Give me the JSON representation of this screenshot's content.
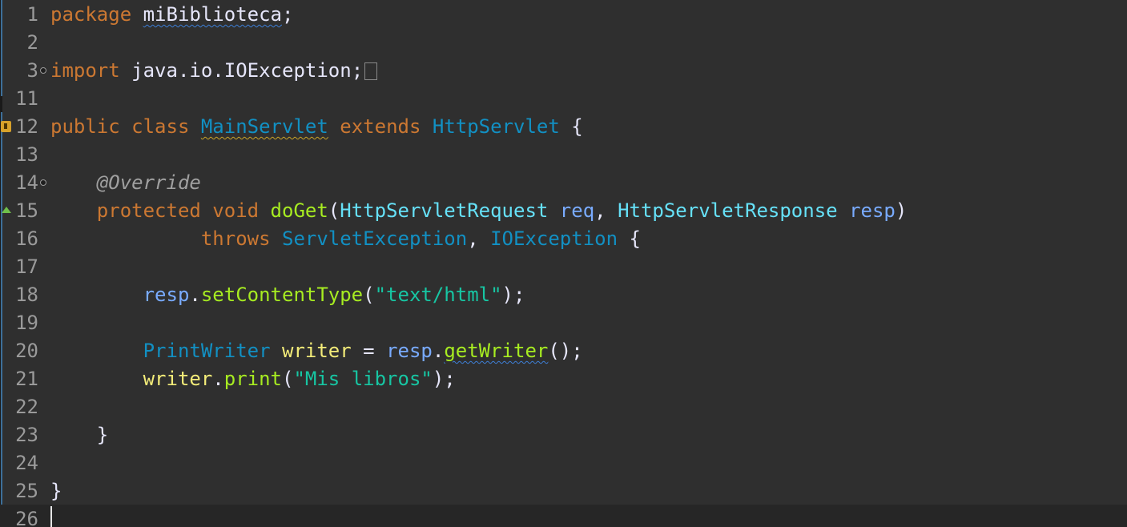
{
  "editor": {
    "lines": [
      {
        "num": "1",
        "tokens": [
          {
            "t": "package",
            "c": "kw"
          },
          {
            "t": " ",
            "c": "plain"
          },
          {
            "t": "miBiblioteca",
            "c": "plain",
            "u": "blue"
          },
          {
            "t": ";",
            "c": "plain"
          }
        ]
      },
      {
        "num": "2",
        "tokens": []
      },
      {
        "num": "3",
        "fold": "collapsed",
        "tokens": [
          {
            "t": "import",
            "c": "kw"
          },
          {
            "t": " java.io.IOException;",
            "c": "plain"
          }
        ]
      },
      {
        "num": "11",
        "tokens": []
      },
      {
        "num": "12",
        "marker": "warning",
        "tokens": [
          {
            "t": "public",
            "c": "kw"
          },
          {
            "t": " ",
            "c": "plain"
          },
          {
            "t": "class",
            "c": "kw"
          },
          {
            "t": " ",
            "c": "plain"
          },
          {
            "t": "MainServlet",
            "c": "cls",
            "u": "gold"
          },
          {
            "t": " ",
            "c": "plain"
          },
          {
            "t": "extends",
            "c": "kw"
          },
          {
            "t": " ",
            "c": "plain"
          },
          {
            "t": "HttpServlet",
            "c": "cls"
          },
          {
            "t": " {",
            "c": "plain"
          }
        ]
      },
      {
        "num": "13",
        "tokens": []
      },
      {
        "num": "14",
        "fold": "expanded",
        "tokens": [
          {
            "t": "    ",
            "c": "plain"
          },
          {
            "t": "@Override",
            "c": "ann"
          }
        ]
      },
      {
        "num": "15",
        "marker": "override",
        "tokens": [
          {
            "t": "    ",
            "c": "plain"
          },
          {
            "t": "protected",
            "c": "kw"
          },
          {
            "t": " ",
            "c": "plain"
          },
          {
            "t": "void",
            "c": "kw"
          },
          {
            "t": " ",
            "c": "plain"
          },
          {
            "t": "doGet",
            "c": "fn"
          },
          {
            "t": "(",
            "c": "plain"
          },
          {
            "t": "HttpServletRequest",
            "c": "fld"
          },
          {
            "t": " ",
            "c": "plain"
          },
          {
            "t": "req",
            "c": "var"
          },
          {
            "t": ", ",
            "c": "plain"
          },
          {
            "t": "HttpServletResponse",
            "c": "fld"
          },
          {
            "t": " ",
            "c": "plain"
          },
          {
            "t": "resp",
            "c": "var"
          },
          {
            "t": ")",
            "c": "plain"
          }
        ]
      },
      {
        "num": "16",
        "tokens": [
          {
            "t": "             ",
            "c": "plain"
          },
          {
            "t": "throws",
            "c": "kw"
          },
          {
            "t": " ",
            "c": "plain"
          },
          {
            "t": "ServletException",
            "c": "cls"
          },
          {
            "t": ", ",
            "c": "plain"
          },
          {
            "t": "IOException",
            "c": "cls"
          },
          {
            "t": " {",
            "c": "plain"
          }
        ]
      },
      {
        "num": "17",
        "tokens": []
      },
      {
        "num": "18",
        "tokens": [
          {
            "t": "        ",
            "c": "plain"
          },
          {
            "t": "resp",
            "c": "var"
          },
          {
            "t": ".",
            "c": "plain"
          },
          {
            "t": "setContentType",
            "c": "fn"
          },
          {
            "t": "(",
            "c": "plain"
          },
          {
            "t": "\"text/html\"",
            "c": "str"
          },
          {
            "t": ");",
            "c": "plain"
          }
        ]
      },
      {
        "num": "19",
        "tokens": []
      },
      {
        "num": "20",
        "tokens": [
          {
            "t": "        ",
            "c": "plain"
          },
          {
            "t": "PrintWriter",
            "c": "cls"
          },
          {
            "t": " ",
            "c": "plain"
          },
          {
            "t": "writer",
            "c": "loc"
          },
          {
            "t": " = ",
            "c": "plain"
          },
          {
            "t": "resp",
            "c": "var"
          },
          {
            "t": ".",
            "c": "plain"
          },
          {
            "t": "getWriter",
            "c": "fn",
            "u": "blue"
          },
          {
            "t": "();",
            "c": "plain"
          }
        ]
      },
      {
        "num": "21",
        "tokens": [
          {
            "t": "        ",
            "c": "plain"
          },
          {
            "t": "writer",
            "c": "loc"
          },
          {
            "t": ".",
            "c": "plain"
          },
          {
            "t": "print",
            "c": "fn"
          },
          {
            "t": "(",
            "c": "plain"
          },
          {
            "t": "\"Mis libros\"",
            "c": "str"
          },
          {
            "t": ");",
            "c": "plain"
          }
        ]
      },
      {
        "num": "22",
        "tokens": []
      },
      {
        "num": "23",
        "tokens": [
          {
            "t": "    }",
            "c": "plain"
          }
        ]
      },
      {
        "num": "24",
        "tokens": []
      },
      {
        "num": "25",
        "tokens": [
          {
            "t": "}",
            "c": "plain"
          }
        ]
      },
      {
        "num": "26",
        "current": true,
        "tokens": []
      }
    ]
  },
  "colors": {
    "background": "#2f2f2f",
    "keyword": "#cc7832",
    "class": "#1290c3",
    "parameter": "#79abff",
    "type": "#66e1f8",
    "method": "#a7ec21",
    "string": "#17c6a3",
    "annotation": "#a0a0a0",
    "local": "#f3ec79"
  },
  "gutter_icons": {
    "12": "warning-icon",
    "15": "override-triangle-icon",
    "3": "fold-collapsed-icon",
    "14": "fold-expanded-icon"
  }
}
